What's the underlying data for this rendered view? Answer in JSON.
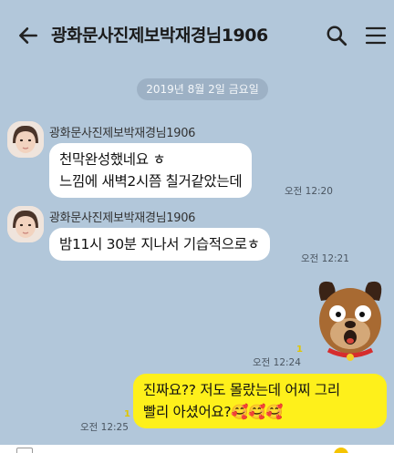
{
  "header": {
    "title": "광화문사진제보박재경님1906",
    "back_icon": "arrow-left-icon",
    "search_icon": "search-icon",
    "menu_icon": "hamburger-menu-icon"
  },
  "date_divider": "2019년 8월 2일 금요일",
  "messages": [
    {
      "sender": "광화문사진제보박재경님1906",
      "lines": [
        "천막완성했네요 ㅎ",
        "느낌에 새벽2시쯤 칠거같았는데"
      ],
      "time": "오전 12:20"
    },
    {
      "sender": "광화문사진제보박재경님1906",
      "lines": [
        "밤11시 30분 지나서 기습적으로ㅎ"
      ],
      "time": "오전 12:21"
    },
    {
      "type": "emoticon",
      "emoticon": "frodo-dog-emoticon",
      "unread": "1",
      "time": "오전 12:24"
    },
    {
      "lines": [
        "진짜요?? 저도 몰랐는데  어찌 그리",
        "빨리  아셨어요?"
      ],
      "emoji": "🥰🥰🥰",
      "unread": "1",
      "time": "오전 12:25"
    }
  ],
  "colors": {
    "background": "#b2c7da",
    "my_bubble": "#fef01b",
    "other_bubble": "#ffffff"
  }
}
